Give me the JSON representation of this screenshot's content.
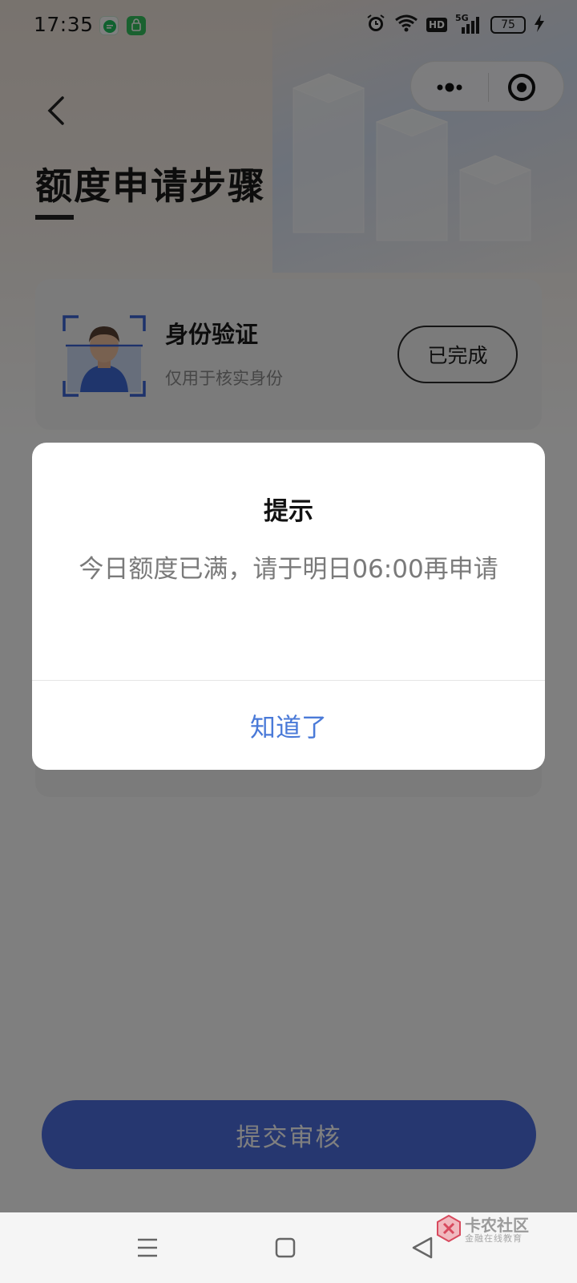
{
  "status_bar": {
    "time": "17:35",
    "battery": "75",
    "network": "5G",
    "hd": "HD",
    "icons": [
      "message-app-icon",
      "store-app-icon",
      "alarm-icon",
      "wifi-icon",
      "hd-icon",
      "signal-icon",
      "battery-icon",
      "charging-icon"
    ]
  },
  "header": {
    "title": "额度申请步骤"
  },
  "capsule": {
    "icons": [
      "more-icon",
      "close-target-icon"
    ]
  },
  "steps": [
    {
      "title": "身份验证",
      "subtitle": "仅用于核实身份",
      "status_button": "已完成"
    }
  ],
  "submit_button": "提交审核",
  "dialog": {
    "title": "提示",
    "message": "今日额度已满，请于明日06:00再申请",
    "confirm": "知道了"
  },
  "watermark": {
    "title": "卡农社区",
    "subtitle": "金融在线教育"
  },
  "colors": {
    "primary": "#4d6fe0",
    "dialog_button": "#4a7ad8",
    "overlay": "rgba(0,0,0,0.5)"
  }
}
